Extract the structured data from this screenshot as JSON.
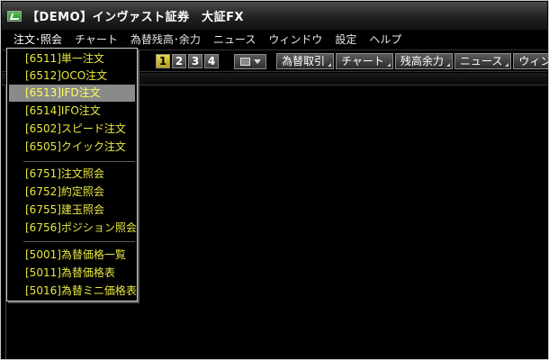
{
  "window": {
    "title": "【DEMO】インヴァスト証券　大証FX",
    "icon": "app-logo-icon"
  },
  "menubar": {
    "items": [
      {
        "label": "注文･照会"
      },
      {
        "label": "チャート"
      },
      {
        "label": "為替残高･余力"
      },
      {
        "label": "ニュース"
      },
      {
        "label": "ウィンドウ"
      },
      {
        "label": "設定"
      },
      {
        "label": "ヘルプ"
      }
    ]
  },
  "toolbar": {
    "screens": [
      "1",
      "2",
      "3",
      "4"
    ],
    "active_screen": "1",
    "buttons": [
      {
        "label": "為替取引"
      },
      {
        "label": "チャート"
      },
      {
        "label": "残高余力"
      },
      {
        "label": "ニュース"
      },
      {
        "label": "ウィンド"
      }
    ]
  },
  "dropdown": {
    "highlighted_index": 2,
    "groups": [
      {
        "items": [
          "[6511]単一注文",
          "[6512]OCO注文",
          "[6513]IFD注文",
          "[6514]IFO注文",
          "[6502]スピード注文",
          "[6505]クイック注文"
        ]
      },
      {
        "items": [
          "[6751]注文照会",
          "[6752]約定照会",
          "[6755]建玉照会",
          "[6756]ポジション照会"
        ]
      },
      {
        "items": [
          "[5001]為替価格一覧",
          "[5011]為替価格表",
          "[5016]為替ミニ価格表"
        ]
      }
    ]
  },
  "colors": {
    "menu_text": "#e8e840",
    "highlight": "#8a8a8a",
    "background": "#000000"
  }
}
